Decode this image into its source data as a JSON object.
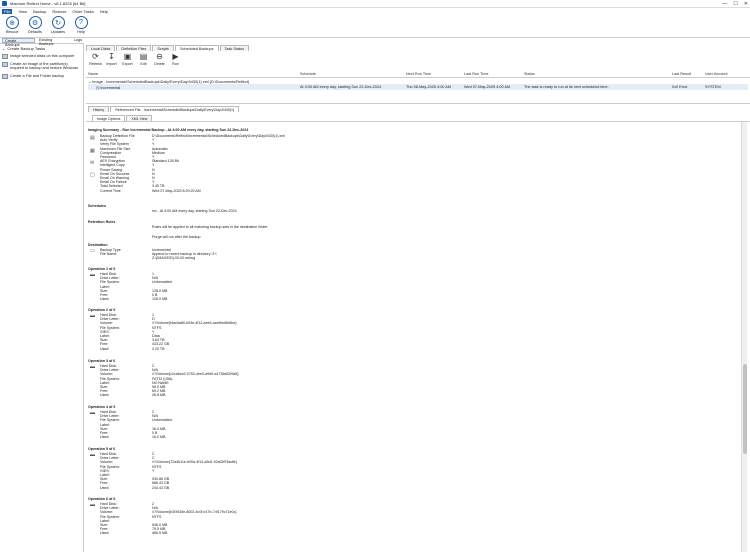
{
  "window": {
    "title": "Macrium Reflect Home - v8.1.8325  [64 Bit]",
    "min": "—",
    "max": "☐",
    "close": "✕"
  },
  "menu": [
    "File",
    "View",
    "Backup",
    "Restore",
    "Other Tasks",
    "Help"
  ],
  "ribbon": [
    {
      "label": "Rescue",
      "icon": "rescue-icon"
    },
    {
      "label": "Defaults",
      "icon": "gear-icon"
    },
    {
      "label": "Updates",
      "icon": "updates-icon"
    },
    {
      "label": "Help",
      "icon": "help-icon"
    }
  ],
  "left_tabs": [
    "Create Backups",
    "Existing Backups",
    "Logs"
  ],
  "left_panel": {
    "header": "Create Backup Tasks",
    "items": [
      "Image selected disks on this computer",
      "Create an image of the partition(s) required to backup and restore Windows",
      "Create a File and Folder backup"
    ]
  },
  "main_tabs": [
    "Local Disks",
    "Definition Files",
    "Scripts",
    "Scheduled Backups",
    "Task Status"
  ],
  "toolbar": [
    {
      "label": "Refresh",
      "icon": "refresh-icon"
    },
    {
      "label": "Import",
      "icon": "import-icon"
    },
    {
      "label": "Export",
      "icon": "save-icon"
    },
    {
      "label": "Edit",
      "icon": "edit-icon"
    },
    {
      "label": "Delete",
      "icon": "delete-icon"
    },
    {
      "label": "Run",
      "icon": "run-icon"
    }
  ],
  "columns": [
    "Name",
    "Schedule",
    "Next Run Time",
    "Last Run Time",
    "Status",
    "Last Result",
    "User Account"
  ],
  "rows": [
    {
      "name": "Image - Incremental\\ScheduledBackups\\Daily\\Every\\Day\\0430(1).xml (D:\\Documents\\Reflect)"
    },
    {
      "name": "Incremental",
      "schedule": "At 4:00 AM every day, starting Sun 22-Dec-2024",
      "next": "Thu 08-May-2025 4:00 AM",
      "last": "Wed 07-May-2025 4:00 AM",
      "status": "The task is ready to run at its next scheduled time.",
      "result": "0x0 Error",
      "account": "SYSTEM"
    }
  ],
  "sub_tabs": [
    "History",
    "Referenced File - Incremental\\ScheduledBackups\\Daily\\Every\\Day\\0430(1)"
  ],
  "inner_tabs": [
    "Image Options",
    "XML View"
  ],
  "summary": {
    "heading": "Imaging Summary - Run Incremental Backup - At 4:00 AM every day, starting Sun 22-Dec-2024",
    "options": [
      [
        "Backup Definition File",
        "D:\\Documents\\Reflect\\Incremental\\ScheduledBackups\\Daily\\Every\\Day\\0430(1).xml"
      ],
      [
        "Auto Verify",
        "Y"
      ],
      [
        "Verify File System",
        "Y"
      ],
      [
        "Maximum File Size",
        "Automatic"
      ],
      [
        "Compression",
        "Medium"
      ],
      [
        "Password",
        "Y"
      ],
      [
        "AES Encryption",
        "Standard 128 Bit"
      ],
      [
        "Intelligent Copy",
        "Y"
      ],
      [
        "Power Saving",
        "N"
      ],
      [
        "Email On Success",
        "N"
      ],
      [
        "Email On Warning",
        "N"
      ],
      [
        "Email On Failure",
        "Y"
      ],
      [
        "Total Selected",
        "3.45 TB"
      ],
      [
        "Current Time",
        "Wed 07-May-2025 8:29:25 AM"
      ]
    ],
    "schedules_title": "Schedules",
    "schedule_line": "Inc - At 4:00 AM every day, starting Sun 22-Dec-2024",
    "retention_title": "Retention Rules",
    "retention_1": "Rules will be applied to all matching backup sets in the destination folder.",
    "retention_2": "Purge will run after the backup",
    "destination_title": "Destination",
    "destination": [
      [
        "Backup Type",
        "Incremental"
      ],
      [
        "File Name",
        "Append to recent backup in directory 'Z:\\'"
      ],
      [
        "",
        "Z:\\{IMAGEID}-00-00.mrimg"
      ]
    ],
    "operations": [
      {
        "title": "Operation 1 of 6",
        "fields": [
          [
            "Hard Disk:",
            "1"
          ],
          [
            "Drive Letter:",
            "N/A"
          ],
          [
            "File System:",
            "Unformatted"
          ],
          [
            "Label:",
            ""
          ],
          [
            "Size:",
            "128.0 MB"
          ],
          [
            "Free:",
            "0 B"
          ],
          [
            "Used:",
            "128.0 MB"
          ]
        ]
      },
      {
        "title": "Operation 2 of 6",
        "fields": [
          [
            "Hard Disk:",
            "1"
          ],
          [
            "Drive Letter:",
            "D"
          ],
          [
            "Volume:",
            "\\\\?\\Volume{f4ac6a80-b09e-4f12-aee5-cea9bc6fe6be}"
          ],
          [
            "File System:",
            "NTFS"
          ],
          [
            "GIES:",
            "Y"
          ],
          [
            "Label:",
            "Data"
          ],
          [
            "Size:",
            "3.64 TB"
          ],
          [
            "Free:",
            "433.22 GB"
          ],
          [
            "Used:",
            "3.20 TB"
          ]
        ]
      },
      {
        "title": "Operation 3 of 6",
        "fields": [
          [
            "Hard Disk:",
            "2"
          ],
          [
            "Drive Letter:",
            "N/A"
          ],
          [
            "Volume:",
            "\\\\?\\Volume{c2ca6cb2-0753-4ee0-a9d9-a4736a52f9a5}"
          ],
          [
            "File System:",
            "FAT32 (LBA)"
          ],
          [
            "Label:",
            "NO NAME"
          ],
          [
            "Size:",
            "96.0 MB"
          ],
          [
            "Free:",
            "69.2 MB"
          ],
          [
            "Used:",
            "26.8 MB"
          ]
        ]
      },
      {
        "title": "Operation 4 of 6",
        "fields": [
          [
            "Hard Disk:",
            "2"
          ],
          [
            "Drive Letter:",
            "N/A"
          ],
          [
            "File System:",
            "Unformatted"
          ],
          [
            "Label:",
            ""
          ],
          [
            "Size:",
            "16.0 MB"
          ],
          [
            "Free:",
            "0 B"
          ],
          [
            "Used:",
            "16.0 MB"
          ]
        ]
      },
      {
        "title": "Operation 5 of 6",
        "fields": [
          [
            "Hard Disk:",
            "2"
          ],
          [
            "Drive Letter:",
            "C"
          ],
          [
            "Volume:",
            "\\\\?\\Volume{72a4b11e-b00d-4f13-a5d1-92a05f76adfe}"
          ],
          [
            "File System:",
            "NTFS"
          ],
          [
            "GIES:",
            "Y"
          ],
          [
            "Label:",
            ""
          ],
          [
            "Size:",
            "930.86 GB"
          ],
          [
            "Free:",
            "686.43 GB"
          ],
          [
            "Used:",
            "244.43 GB"
          ]
        ]
      },
      {
        "title": "Operation 6 of 6",
        "fields": [
          [
            "Hard Disk:",
            "2"
          ],
          [
            "Drive Letter:",
            "N/A"
          ],
          [
            "Volume:",
            "\\\\?\\Volume{b3f3935e-8002-4c0f-b17b-74f179c71e0c}"
          ],
          [
            "File System:",
            "NTFS"
          ],
          [
            "Label:",
            ""
          ],
          [
            "Size:",
            "546.0 MB"
          ],
          [
            "Free:",
            "79.5 MB"
          ],
          [
            "Used:",
            "466.5 MB"
          ]
        ]
      }
    ]
  }
}
